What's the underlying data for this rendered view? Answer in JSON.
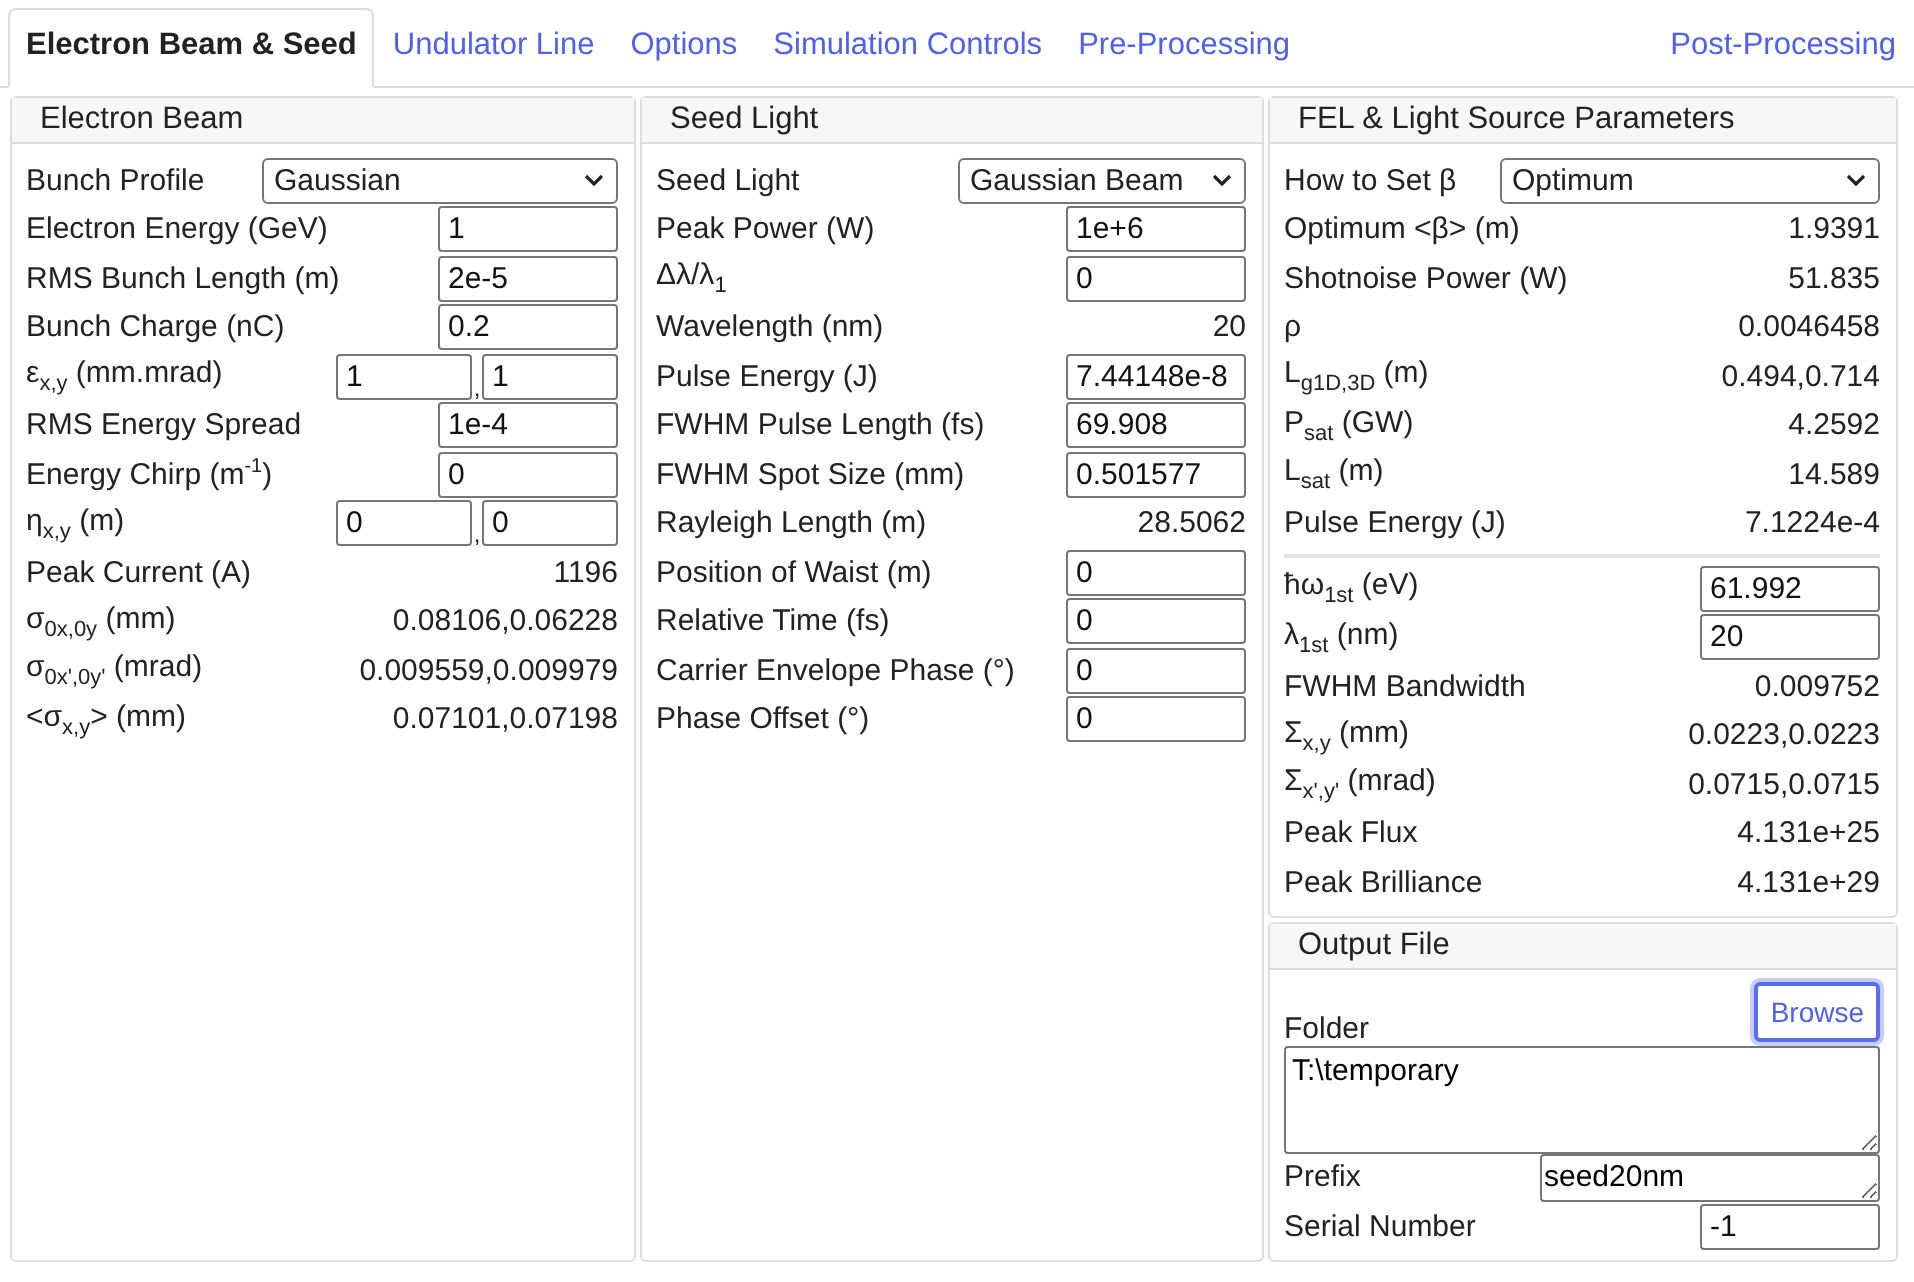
{
  "tabs": [
    {
      "label": "Electron Beam & Seed",
      "selected": true
    },
    {
      "label": "Undulator Line",
      "selected": false
    },
    {
      "label": "Options",
      "selected": false
    },
    {
      "label": "Simulation Controls",
      "selected": false
    },
    {
      "label": "Pre-Processing",
      "selected": false
    },
    {
      "label": "Post-Processing",
      "selected": false
    }
  ],
  "columns": [
    {
      "panels": [
        {
          "title": "Electron Beam",
          "rows": [
            {
              "kind": "select",
              "label": "Bunch Profile",
              "value": "Gaussian"
            },
            {
              "kind": "input",
              "label": "Electron Energy (GeV)",
              "value": "1"
            },
            {
              "kind": "input",
              "label": "RMS Bunch Length (m)",
              "value": "2e-5"
            },
            {
              "kind": "input",
              "label": "Bunch Charge (nC)",
              "value": "0.2"
            },
            {
              "kind": "pair",
              "label": "ε$_{x,y}$ (mm.mrad)",
              "values": [
                "1",
                "1"
              ],
              "separator": ","
            },
            {
              "kind": "input",
              "label": "RMS Energy Spread",
              "value": "1e-4"
            },
            {
              "kind": "input",
              "label": "Energy Chirp (m$^{-1}$)",
              "value": "0"
            },
            {
              "kind": "pair",
              "label": "η$_{x,y}$ (m)",
              "values": [
                "0",
                "0"
              ],
              "separator": ","
            },
            {
              "kind": "value",
              "label": "Peak Current (A)",
              "value": "1196"
            },
            {
              "kind": "value",
              "label": "σ$_{0x,0y}$ (mm)",
              "value": "0.08106,0.06228"
            },
            {
              "kind": "value",
              "label": "σ$_{0x',0y'}$ (mrad)",
              "value": "0.009559,0.009979"
            },
            {
              "kind": "value",
              "label": "<σ$_{x,y}$> (mm)",
              "value": "0.07101,0.07198"
            }
          ]
        }
      ]
    },
    {
      "panels": [
        {
          "title": "Seed Light",
          "rows": [
            {
              "kind": "select",
              "label": "Seed Light",
              "value": "Gaussian Beam"
            },
            {
              "kind": "input",
              "label": "Peak Power (W)",
              "value": "1e+6"
            },
            {
              "kind": "input",
              "label": "Δλ/λ$_{1}$",
              "value": "0"
            },
            {
              "kind": "value",
              "label": "Wavelength (nm)",
              "value": "20"
            },
            {
              "kind": "input",
              "label": "Pulse Energy (J)",
              "value": "7.44148e-8"
            },
            {
              "kind": "input",
              "label": "FWHM Pulse Length (fs)",
              "value": "69.908"
            },
            {
              "kind": "input",
              "label": "FWHM Spot Size (mm)",
              "value": "0.501577"
            },
            {
              "kind": "value",
              "label": "Rayleigh Length (m)",
              "value": "28.5062"
            },
            {
              "kind": "input",
              "label": "Position of Waist (m)",
              "value": "0"
            },
            {
              "kind": "input",
              "label": "Relative Time (fs)",
              "value": "0"
            },
            {
              "kind": "input",
              "label": "Carrier Envelope Phase (°)",
              "value": "0"
            },
            {
              "kind": "input",
              "label": "Phase Offset (°)",
              "value": "0"
            }
          ]
        }
      ]
    },
    {
      "panels": [
        {
          "title": "FEL & Light Source Parameters",
          "rows": [
            {
              "kind": "select",
              "label": "How to Set β",
              "value": "Optimum"
            },
            {
              "kind": "value",
              "label": "Optimum <β> (m)",
              "value": "1.9391"
            },
            {
              "kind": "value",
              "label": "Shotnoise Power (W)",
              "value": "51.835"
            },
            {
              "kind": "value",
              "label": "ρ",
              "value": "0.0046458"
            },
            {
              "kind": "value",
              "label": "L$_{g1D,3D}$ (m)",
              "value": "0.494,0.714"
            },
            {
              "kind": "value",
              "label": "P$_{sat}$ (GW)",
              "value": "4.2592"
            },
            {
              "kind": "value",
              "label": "L$_{sat}$ (m)",
              "value": "14.589"
            },
            {
              "kind": "value",
              "label": "Pulse Energy (J)",
              "value": "7.1224e-4"
            },
            {
              "kind": "input",
              "label": "ħω$_{1st}$ (eV)",
              "value": "61.992",
              "separator_above": true
            },
            {
              "kind": "input",
              "label": "λ$_{1st}$ (nm)",
              "value": "20"
            },
            {
              "kind": "value",
              "label": "FWHM Bandwidth",
              "value": "0.009752"
            },
            {
              "kind": "value",
              "label": "Σ$_{x,y}$ (mm)",
              "value": "0.0223,0.0223"
            },
            {
              "kind": "value",
              "label": "Σ$_{x',y'}$ (mrad)",
              "value": "0.0715,0.0715"
            },
            {
              "kind": "value",
              "label": "Peak Flux",
              "value": "4.131e+25"
            },
            {
              "kind": "value",
              "label": "Peak Brilliance",
              "value": "4.131e+29"
            }
          ]
        },
        {
          "title": "Output File",
          "rows": [
            {
              "kind": "folder",
              "label": "Folder",
              "button": "Browse",
              "focused": true,
              "value": "T:\\temporary"
            },
            {
              "kind": "textline",
              "label": "Prefix",
              "value": "seed20nm"
            },
            {
              "kind": "input",
              "label": "Serial Number",
              "value": "-1"
            }
          ]
        }
      ]
    }
  ]
}
